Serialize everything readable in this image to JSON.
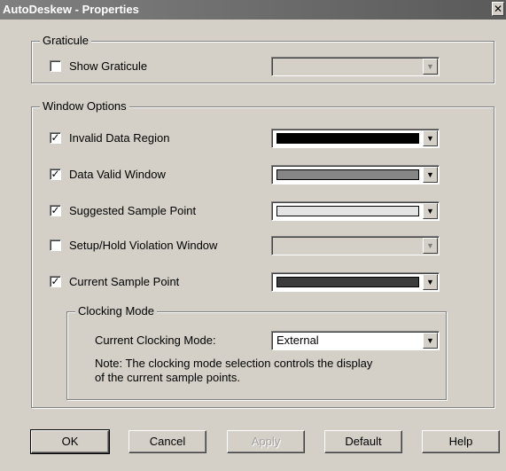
{
  "window": {
    "title": "AutoDeskew - Properties",
    "close_glyph": "✕"
  },
  "graticule": {
    "group_label": "Graticule",
    "show": {
      "label": "Show Graticule",
      "checked": false,
      "enabled": true
    },
    "color_enabled": false
  },
  "window_options": {
    "group_label": "Window Options",
    "items": [
      {
        "label": "Invalid Data Region",
        "checked": true,
        "color": "#000000",
        "enabled": true
      },
      {
        "label": "Data Valid Window",
        "checked": true,
        "color": "#868686",
        "enabled": true
      },
      {
        "label": "Suggested Sample Point",
        "checked": true,
        "color": "#e4e4e4",
        "enabled": true
      },
      {
        "label": "Setup/Hold Violation Window",
        "checked": false,
        "color": null,
        "enabled": false
      },
      {
        "label": "Current Sample Point",
        "checked": true,
        "color": "#3c3c3c",
        "enabled": true
      }
    ]
  },
  "clocking_mode": {
    "group_label": "Clocking Mode",
    "field_label": "Current Clocking Mode:",
    "value": "External",
    "note_line1": "Note: The clocking mode selection controls the display",
    "note_line2": "of the current sample points."
  },
  "buttons": {
    "ok": "OK",
    "cancel": "Cancel",
    "apply": "Apply",
    "default": "Default",
    "help": "Help"
  }
}
